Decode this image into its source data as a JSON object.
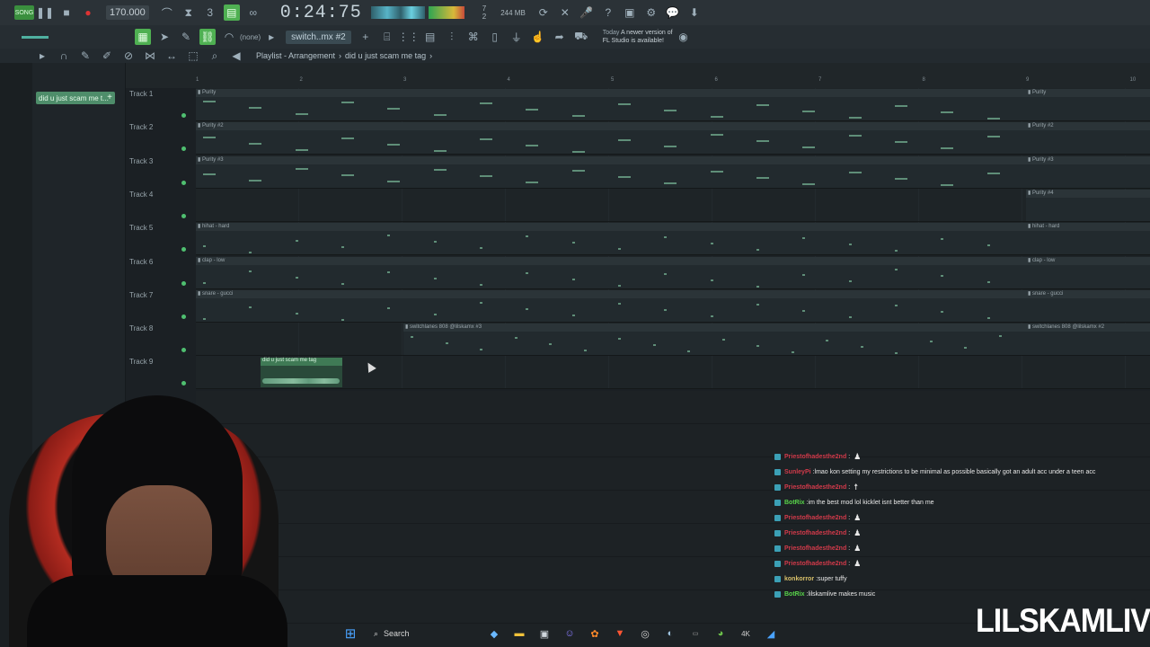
{
  "toolbar": {
    "song_mode": "SONG",
    "tempo": "170.000",
    "time": "0:24:75",
    "time_suffix": "M:S:CS",
    "cpu_line1": "7",
    "cpu_line2": "2",
    "mem": "244 MB",
    "mixer_channel": "switch..mx #2",
    "none_label": "(none)",
    "news_prefix": "Today",
    "news_text": "A newer version of",
    "news_text2": "FL Studio is available!"
  },
  "playlist": {
    "title": "Playlist - Arrangement",
    "breadcrumb": "did u just scam me tag",
    "pattern_selected": "did u just scam me t...",
    "ruler": [
      "1",
      "2",
      "3",
      "4",
      "5",
      "6",
      "7",
      "8",
      "9",
      "10"
    ],
    "tracks": [
      {
        "name": "Track 1",
        "clip": "Purity",
        "clip_right": "Purity"
      },
      {
        "name": "Track 2",
        "clip": "Purity #2",
        "clip_right": "Purity #2"
      },
      {
        "name": "Track 3",
        "clip": "Purity #3",
        "clip_right": "Purity #3"
      },
      {
        "name": "Track 4",
        "clip": "",
        "clip_right": "Purity #4"
      },
      {
        "name": "Track 5",
        "clip": "hihat - hard",
        "clip_right": "hihat - hard"
      },
      {
        "name": "Track 6",
        "clip": "clap - low",
        "clip_right": "clap - low"
      },
      {
        "name": "Track 7",
        "clip": "snare - gucci",
        "clip_right": "snare - gucci"
      },
      {
        "name": "Track 8",
        "clip": "switchlanes 808 @lilskamx #3",
        "clip_right": "switchlanes 808 @lilskamx #2"
      },
      {
        "name": "Track 9",
        "clip": "did u just scam me tag",
        "clip_right": ""
      }
    ]
  },
  "chat": [
    {
      "user": "Priestofhadesthe2nd",
      "message": "",
      "emote": "♟",
      "color": "#d23a4a"
    },
    {
      "user": "SunleyPi",
      "message": " lmao kon setting my restrictions to be minimal as possible basically got an adult acc under a teen acc",
      "emote": "",
      "color": "#d23a4a"
    },
    {
      "user": "Priestofhadesthe2nd",
      "message": "",
      "emote": "☨",
      "color": "#d23a4a"
    },
    {
      "user": "BotRix",
      "message": " im the best mod lol kicklet isnt better than me",
      "emote": "",
      "color": "#58d44a"
    },
    {
      "user": "Priestofhadesthe2nd",
      "message": "",
      "emote": "♟",
      "color": "#d23a4a"
    },
    {
      "user": "Priestofhadesthe2nd",
      "message": "",
      "emote": "♟",
      "color": "#d23a4a"
    },
    {
      "user": "Priestofhadesthe2nd",
      "message": "",
      "emote": "♟",
      "color": "#d23a4a"
    },
    {
      "user": "Priestofhadesthe2nd",
      "message": "",
      "emote": "♟",
      "color": "#d23a4a"
    },
    {
      "user": "konkorror",
      "message": " super tuffy",
      "emote": "",
      "color": "#d8c06a"
    },
    {
      "user": "BotRix",
      "message": " lilskamlive makes music",
      "emote": "",
      "color": "#58d44a"
    }
  ],
  "taskbar": {
    "search_label": "Search",
    "icons": [
      "windows-start-icon",
      "copilot-icon",
      "file-explorer-icon",
      "store-icon",
      "discord-icon",
      "fl-studio-icon",
      "brave-icon",
      "chrome-icon",
      "steam-icon",
      "app-icon",
      "chart-icon",
      "4k-icon",
      "app2-icon"
    ]
  },
  "watermark": "LILSKAMLIVE"
}
